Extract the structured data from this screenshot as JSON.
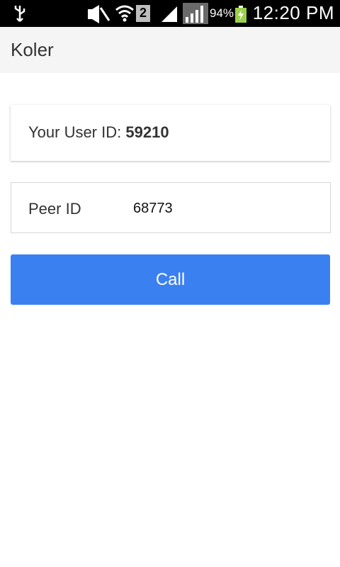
{
  "status_bar": {
    "icons": [
      "usb-icon",
      "mute-icon",
      "wifi-icon",
      "sim-icon",
      "signal-icon",
      "signal-icon",
      "battery-charging-icon"
    ],
    "sim_number": "2",
    "battery_percent": "94%",
    "time": "12:20 PM"
  },
  "app_bar": {
    "title": "Koler"
  },
  "user_card": {
    "label": "Your User ID:",
    "value": "59210"
  },
  "peer": {
    "label": "Peer ID",
    "value": "68773"
  },
  "call_button": {
    "label": "Call",
    "color": "#3b80f0"
  }
}
